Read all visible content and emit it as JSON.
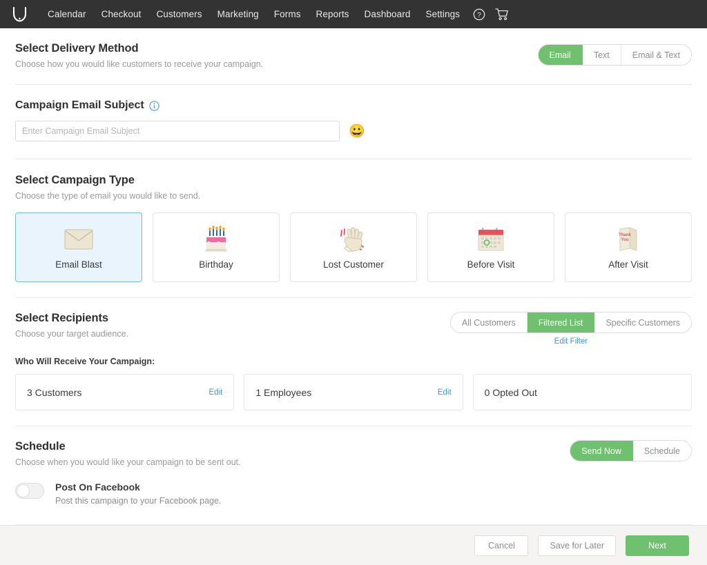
{
  "nav": {
    "logo_icon": "vagaro-v-logo",
    "items": [
      {
        "label": "Calendar"
      },
      {
        "label": "Checkout"
      },
      {
        "label": "Customers"
      },
      {
        "label": "Marketing"
      },
      {
        "label": "Forms"
      },
      {
        "label": "Reports"
      },
      {
        "label": "Dashboard"
      },
      {
        "label": "Settings"
      }
    ],
    "help_icon": "help-circle-icon",
    "cart_icon": "shopping-cart-icon"
  },
  "delivery": {
    "title": "Select Delivery Method",
    "subtitle": "Choose how you would like customers to receive your campaign.",
    "options": [
      {
        "label": "Email",
        "active": true
      },
      {
        "label": "Text",
        "active": false
      },
      {
        "label": "Email & Text",
        "active": false
      }
    ]
  },
  "subject": {
    "label": "Campaign Email Subject",
    "info_icon": "info-circle-icon",
    "value": "",
    "placeholder": "Enter Campaign Email Subject",
    "emoji_icon": "grinning-face-emoji",
    "emoji_glyph": "😀"
  },
  "campaign_type": {
    "title": "Select Campaign Type",
    "subtitle": "Choose the type of email you would like to send.",
    "cards": [
      {
        "label": "Email Blast",
        "icon": "envelope-icon",
        "selected": true
      },
      {
        "label": "Birthday",
        "icon": "birthday-cake-icon",
        "selected": false
      },
      {
        "label": "Lost Customer",
        "icon": "waving-hand-icon",
        "selected": false
      },
      {
        "label": "Before Visit",
        "icon": "calendar-icon",
        "selected": false
      },
      {
        "label": "After Visit",
        "icon": "thank-you-card-icon",
        "selected": false
      }
    ]
  },
  "recipients": {
    "title": "Select Recipients",
    "subtitle": "Choose your target audience.",
    "options": [
      {
        "label": "All Customers",
        "active": false
      },
      {
        "label": "Filtered List",
        "active": true
      },
      {
        "label": "Specific Customers",
        "active": false
      }
    ],
    "edit_filter_label": "Edit Filter",
    "who_label": "Who Will Receive Your Campaign:",
    "boxes": [
      {
        "count_label": "3 Customers",
        "edit_label": "Edit",
        "has_edit": true
      },
      {
        "count_label": "1 Employees",
        "edit_label": "Edit",
        "has_edit": true
      },
      {
        "count_label": "0 Opted Out",
        "edit_label": "",
        "has_edit": false
      }
    ]
  },
  "schedule": {
    "title": "Schedule",
    "subtitle": "Choose when you would like your campaign to be sent out.",
    "options": [
      {
        "label": "Send Now",
        "active": true
      },
      {
        "label": "Schedule",
        "active": false
      }
    ],
    "facebook": {
      "toggle_state": "off",
      "title": "Post On Facebook",
      "subtitle": "Post this campaign to your Facebook page."
    }
  },
  "footer": {
    "cancel_label": "Cancel",
    "save_label": "Save for Later",
    "next_label": "Next"
  },
  "colors": {
    "accent_green": "#6fc06f",
    "link_blue": "#3b95d8",
    "nav_dark": "#333333",
    "selected_card_bg": "#e9f4fd",
    "selected_card_border": "#78b9e8"
  }
}
